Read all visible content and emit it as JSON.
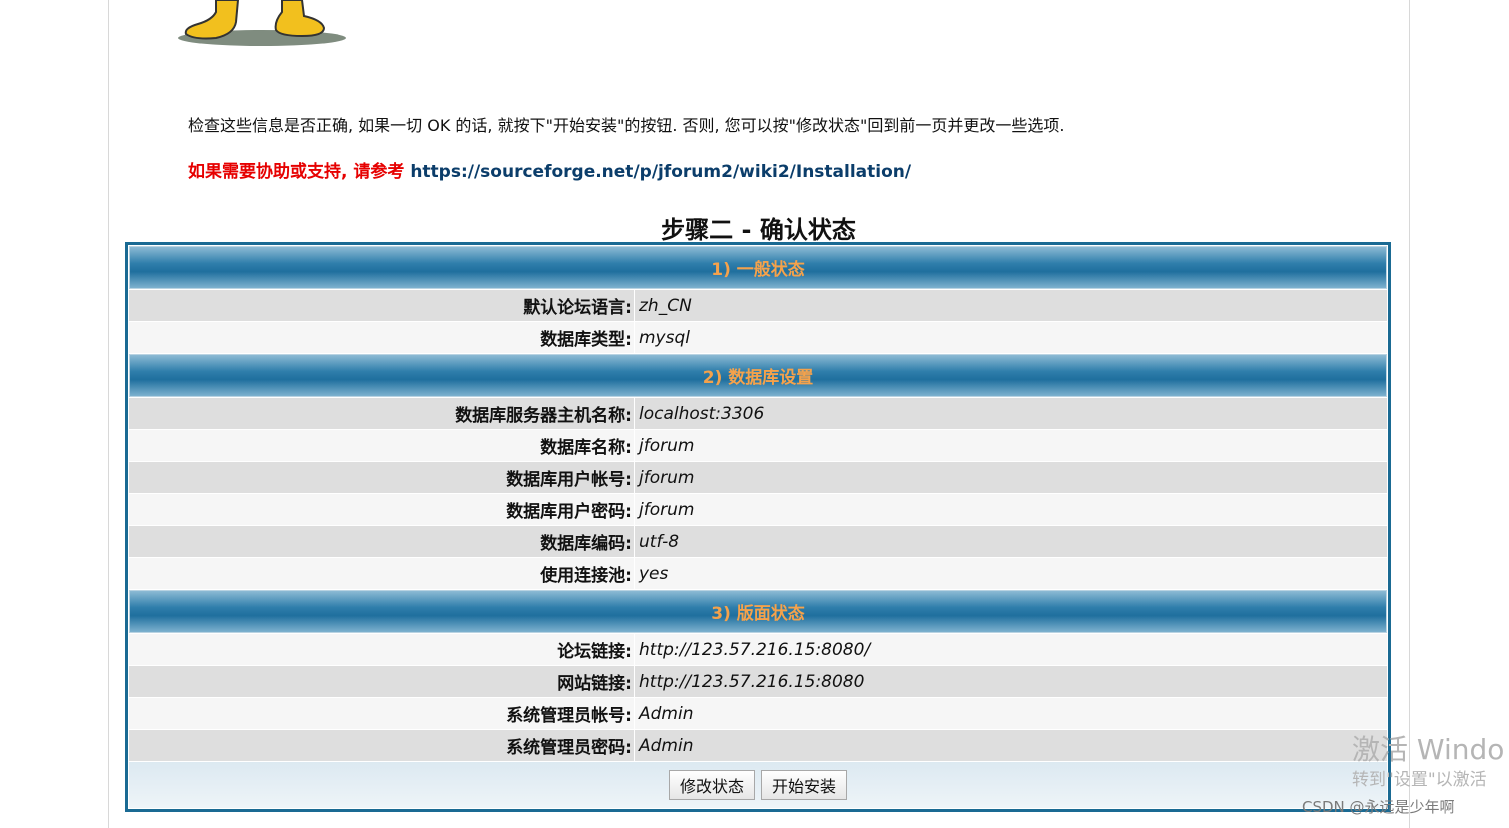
{
  "intro_text": "检查这些信息是否正确, 如果一切 OK 的话, 就按下\"开始安装\"的按钮. 否则, 您可以按\"修改状态\"回到前一页并更改一些选项.",
  "help": {
    "prefix": "如果需要协助或支持, 请参考",
    "link": "https://sourceforge.net/p/jforum2/wiki2/Installation/"
  },
  "step_title": "步骤二 - 确认状态",
  "sections": [
    {
      "header": "1) 一般状态",
      "rows": [
        {
          "label": "默认论坛语言:",
          "value": "zh_CN"
        },
        {
          "label": "数据库类型:",
          "value": "mysql"
        }
      ]
    },
    {
      "header": "2) 数据库设置",
      "rows": [
        {
          "label": "数据库服务器主机名称:",
          "value": "localhost:3306"
        },
        {
          "label": "数据库名称:",
          "value": "jforum"
        },
        {
          "label": "数据库用户帐号:",
          "value": "jforum"
        },
        {
          "label": "数据库用户密码:",
          "value": "jforum"
        },
        {
          "label": "数据库编码:",
          "value": "utf-8"
        },
        {
          "label": "使用连接池:",
          "value": "yes"
        }
      ]
    },
    {
      "header": "3) 版面状态",
      "rows": [
        {
          "label": "论坛链接:",
          "value": "http://123.57.216.15:8080/"
        },
        {
          "label": "网站链接:",
          "value": "http://123.57.216.15:8080"
        },
        {
          "label": "系统管理员帐号:",
          "value": "Admin"
        },
        {
          "label": "系统管理员密码:",
          "value": "Admin"
        }
      ]
    }
  ],
  "buttons": {
    "back": "修改状态",
    "install": "开始安装"
  },
  "watermark": {
    "line1": "激活 Windo",
    "line2": "转到\"设置\"以激活"
  },
  "csdn_credit": "CSDN @永远是少年啊",
  "colors": {
    "header_text": "#f5a24b",
    "help_red": "#e60000",
    "link_blue": "#0b3d6a",
    "table_border": "#1a6a93"
  }
}
